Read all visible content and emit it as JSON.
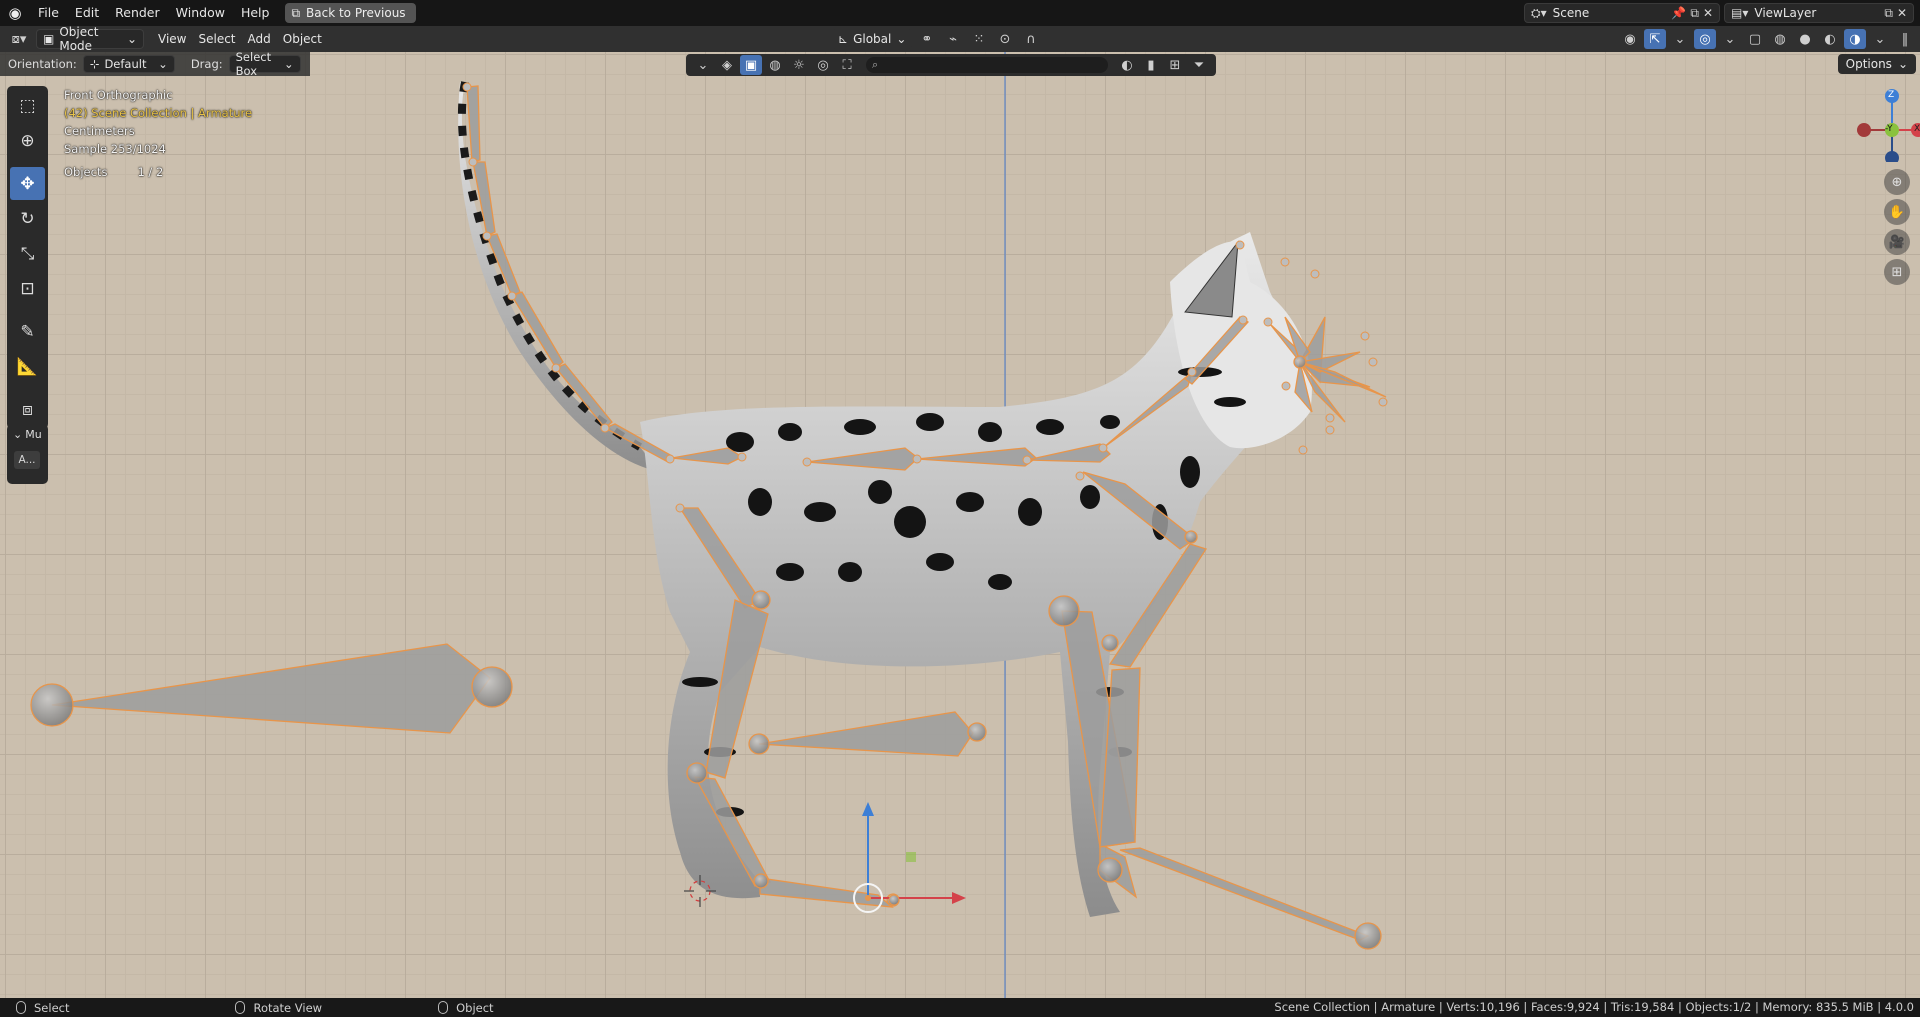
{
  "menu": {
    "items": [
      "File",
      "Edit",
      "Render",
      "Window",
      "Help"
    ],
    "back_button": "Back to Previous"
  },
  "scene": {
    "name": "Scene",
    "view_layer": "ViewLayer"
  },
  "header": {
    "mode": "Object Mode",
    "menus": [
      "View",
      "Select",
      "Add",
      "Object"
    ],
    "transform_orientation": "Global"
  },
  "tool_settings": {
    "orientation_label": "Orientation:",
    "orientation_value": "Default",
    "drag_label": "Drag:",
    "drag_value": "Select Box"
  },
  "options_label": "Options",
  "viewport_info": {
    "view_name": "Front Orthographic",
    "collection": "(42) Scene Collection | Armature",
    "units": "Centimeters",
    "sample": "Sample 253/1024",
    "objects_label": "Objects",
    "objects_value": "1 / 2"
  },
  "side_panel": {
    "collapse_label": "Mu",
    "button_label": "A..."
  },
  "gizmo": {
    "z": "Z",
    "y": "-Y",
    "x": "X"
  },
  "statusbar": {
    "select": "Select",
    "rotate_view": "Rotate View",
    "object": "Object",
    "stats": "Scene Collection | Armature | Verts:10,196 | Faces:9,924 | Tris:19,584 | Objects:1/2 | Memory: 835.5 MiB | 4.0.0"
  },
  "colors": {
    "accent": "#4772b3",
    "bone_outline": "#e8954a",
    "axis_x": "#d4424a",
    "axis_y": "#8ac23e",
    "axis_z": "#3d7fd6"
  }
}
